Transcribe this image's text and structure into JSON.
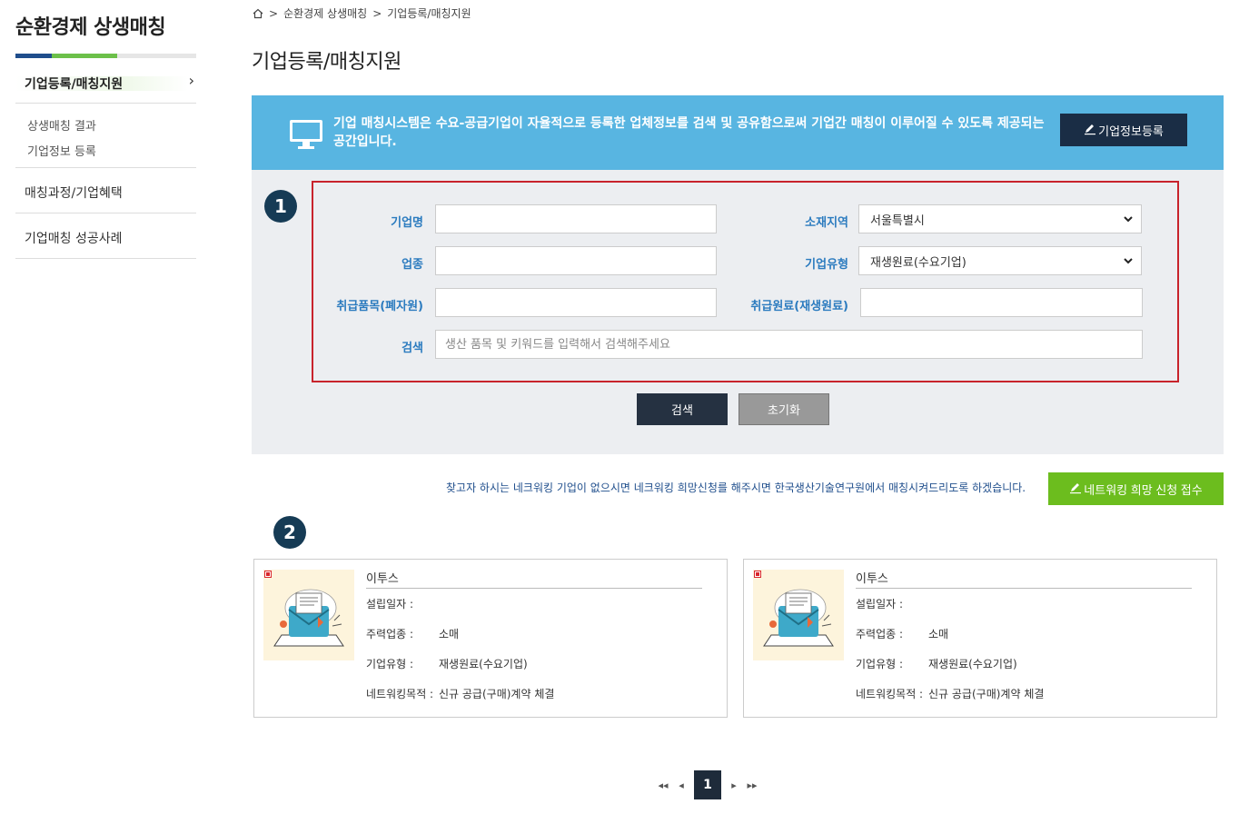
{
  "sidebar": {
    "title": "순환경제 상생매칭",
    "active_item": "기업등록/매칭지원",
    "sub_items": [
      "상생매칭 결과",
      "기업정보 등록"
    ],
    "items": [
      "매칭과정/기업혜택",
      "기업매칭 성공사례"
    ],
    "colors": {
      "bar_dark": "#1f4e8c",
      "bar_green": "#6cc04a"
    }
  },
  "breadcrumb": {
    "separator": ">",
    "items": [
      "순환경제 상생매칭",
      "기업등록/매칭지원"
    ]
  },
  "page_title": "기업등록/매칭지원",
  "banner": {
    "text": "기업 매칭시스템은 수요-공급기업이 자율적으로 등록한 업체정보를 검색 및 공유함으로써 기업간 매칭이 이루어질 수 있도록 제공되는 공간입니다.",
    "register_button": "기업정보등록",
    "color": "#58b5e1"
  },
  "search": {
    "badge": "1",
    "fields": {
      "company_name": {
        "label": "기업명",
        "value": ""
      },
      "region": {
        "label": "소재지역",
        "selected": "서울특별시"
      },
      "industry": {
        "label": "업종",
        "value": ""
      },
      "company_type": {
        "label": "기업유형",
        "selected": "재생원료(수요기업)"
      },
      "handled_items": {
        "label": "취급품목(폐자원)",
        "value": ""
      },
      "handled_materials": {
        "label": "취급원료(재생원료)",
        "value": ""
      },
      "keyword": {
        "label": "검색",
        "placeholder": "생산 품목 및 키워드를 입력해서 검색해주세요"
      }
    },
    "search_button": "검색",
    "reset_button": "초기화"
  },
  "networking": {
    "notice": "찾고자 하시는 네크워킹 기업이 없으시면 네크워킹 희망신청를 해주시면 한국생산기술연구원에서 매칭시켜드리도록 하겠습니다.",
    "button": "네트워킹 희망 신청 접수",
    "color": "#6cbd1e"
  },
  "results": {
    "badge": "2",
    "cards": [
      {
        "name": "이투스",
        "rows": [
          {
            "key": "설립일자 :",
            "value": ""
          },
          {
            "key": "주력업종 :",
            "value": "소매"
          },
          {
            "key": "기업유형 :",
            "value": "재생원료(수요기업)"
          },
          {
            "key": "네트워킹목적 :",
            "value": "신규 공급(구매)계약 체결"
          }
        ]
      },
      {
        "name": "이투스",
        "rows": [
          {
            "key": "설립일자 :",
            "value": ""
          },
          {
            "key": "주력업종 :",
            "value": "소매"
          },
          {
            "key": "기업유형 :",
            "value": "재생원료(수요기업)"
          },
          {
            "key": "네트워킹목적 :",
            "value": "신규 공급(구매)계약 체결"
          }
        ]
      }
    ]
  },
  "pagination": {
    "first": "◂◂",
    "prev": "◂",
    "current": "1",
    "next": "▸",
    "last": "▸▸"
  }
}
